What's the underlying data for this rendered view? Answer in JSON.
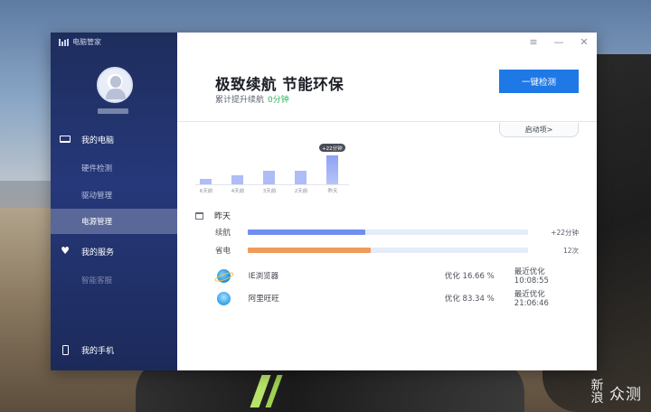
{
  "app": {
    "title": "电脑管家",
    "window_controls": {
      "menu": "≡",
      "minimize": "—",
      "close": "✕"
    }
  },
  "sidebar": {
    "sections": [
      {
        "label": "我的电脑",
        "icon": "laptop-icon"
      },
      {
        "label": "我的服务",
        "icon": "heart-icon"
      },
      {
        "label": "我的手机",
        "icon": "phone-icon"
      }
    ],
    "sub_items": [
      "硬件检测",
      "驱动管理",
      "电源管理",
      "智能客服"
    ],
    "active_item": "电源管理"
  },
  "header": {
    "headline": "极致续航 节能环保",
    "subline_prefix": "累计提升续航",
    "subline_value": "0分钟",
    "detect_button": "一键检测",
    "startup_tab": "启动项>"
  },
  "chart_data": {
    "type": "bar",
    "categories": [
      "6天前",
      "4天前",
      "3天前",
      "2天前",
      "昨天"
    ],
    "values": [
      1,
      1.5,
      2.4,
      2.4,
      5
    ],
    "highlight_label": "+22分钟",
    "highlight_index": 4
  },
  "yesterday": {
    "title": "昨天",
    "metrics": [
      {
        "label": "续航",
        "value": "+22分钟",
        "fill_fraction": 0.42,
        "color": "#6f8ff0"
      },
      {
        "label": "省电",
        "value": "12次",
        "fill_fraction": 0.44,
        "color": "#f09a5c"
      }
    ]
  },
  "programs": [
    {
      "name": "IE浏览器",
      "icon": "ie-browser-icon",
      "optimize": "优化 16.66 %",
      "last": "最近优化10:08:55"
    },
    {
      "name": "阿里旺旺",
      "icon": "aliwangwang-icon",
      "optimize": "优化 83.34 %",
      "last": "最近优化21:06:46"
    }
  ],
  "watermark": {
    "text1": "新",
    "text2": "浪",
    "text3": "众测"
  },
  "colors": {
    "sidebar_top": "#1e2d5c",
    "accent": "#1e78e6",
    "green": "#2db35d"
  }
}
